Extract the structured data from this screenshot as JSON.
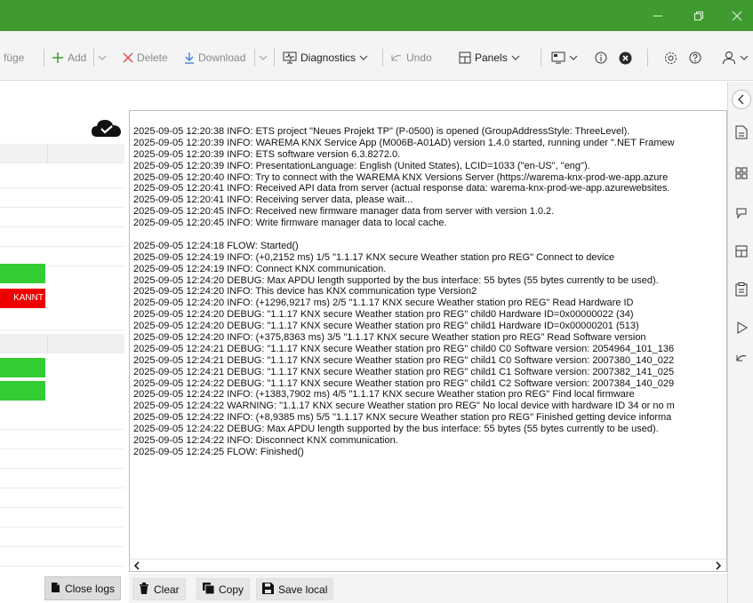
{
  "toolbar": {
    "insert_label": "füge",
    "add_label": "Add",
    "delete_label": "Delete",
    "download_label": "Download",
    "diagnostics_label": "Diagnostics",
    "undo_label": "Undo",
    "panels_label": "Panels"
  },
  "left_pane": {
    "red_cell_text": "KANNT"
  },
  "log": {
    "lines": [
      "2025-09-05 12:20:38 INFO: ETS project \"Neues Projekt TP\" (P-0500) is opened (GroupAddressStyle: ThreeLevel).",
      "2025-09-05 12:20:39 INFO: WAREMA KNX Service App (M006B-A01AD) version 1.4.0 started, running under \".NET Framew",
      "2025-09-05 12:20:39 INFO: ETS software version 6.3.8272.0.",
      "2025-09-05 12:20:39 INFO: PresentationLanguage: English (United States), LCID=1033 (\"en-US\", \"eng\").",
      "2025-09-05 12:20:40 INFO: Try to connect with the WAREMA KNX Versions Server (https://warema-knx-prod-we-app.azure",
      "2025-09-05 12:20:41 INFO: Received API data from server (actual response data: warema-knx-prod-we-app.azurewebsites.",
      "2025-09-05 12:20:41 INFO: Receiving server data, please wait...",
      "2025-09-05 12:20:45 INFO: Received new firmware manager data from server with version 1.0.2.",
      "2025-09-05 12:20:45 INFO: Write firmware manager data to local cache.",
      "",
      "2025-09-05 12:24:18 FLOW: Started()",
      "2025-09-05 12:24:19 INFO: (+0,2152 ms) 1/5 \"1.1.17 KNX secure Weather station pro REG\" Connect to device",
      "2025-09-05 12:24:19 INFO: Connect KNX communication.",
      "2025-09-05 12:24:20 DEBUG: Max APDU length supported by the bus interface: 55 bytes (55 bytes currently to be used).",
      "2025-09-05 12:24:20 INFO: This device has KNX communication type Version2",
      "2025-09-05 12:24:20 INFO: (+1296,9217 ms) 2/5 \"1.1.17 KNX secure Weather station pro REG\" Read Hardware ID",
      "2025-09-05 12:24:20 DEBUG: \"1.1.17 KNX secure Weather station pro REG\" child0 Hardware ID=0x00000022 (34)",
      "2025-09-05 12:24:20 DEBUG: \"1.1.17 KNX secure Weather station pro REG\" child1 Hardware ID=0x00000201 (513)",
      "2025-09-05 12:24:20 INFO: (+375,8363 ms) 3/5 \"1.1.17 KNX secure Weather station pro REG\" Read Software version",
      "2025-09-05 12:24:21 DEBUG: \"1.1.17 KNX secure Weather station pro REG\" child0 C0 Software version: 2054964_101_136",
      "2025-09-05 12:24:21 DEBUG: \"1.1.17 KNX secure Weather station pro REG\" child1 C0 Software version: 2007380_140_022",
      "2025-09-05 12:24:21 DEBUG: \"1.1.17 KNX secure Weather station pro REG\" child1 C1 Software version: 2007382_141_025",
      "2025-09-05 12:24:22 DEBUG: \"1.1.17 KNX secure Weather station pro REG\" child1 C2 Software version: 2007384_140_029",
      "2025-09-05 12:24:22 INFO: (+1383,7902 ms) 4/5 \"1.1.17 KNX secure Weather station pro REG\" Find local firmware",
      "2025-09-05 12:24:22 WARNING: \"1.1.17 KNX secure Weather station pro REG\" No local device with hardware ID 34 or no m",
      "2025-09-05 12:24:22 INFO: (+8,9385 ms) 5/5 \"1.1.17 KNX secure Weather station pro REG\" Finished getting device informa",
      "2025-09-05 12:24:22 DEBUG: Max APDU length supported by the bus interface: 55 bytes (55 bytes currently to be used).",
      "2025-09-05 12:24:22 INFO: Disconnect KNX communication.",
      "2025-09-05 12:24:25 FLOW: Finished()"
    ]
  },
  "buttons": {
    "close_logs": "Close logs",
    "clear": "Clear",
    "copy": "Copy",
    "save_local": "Save local"
  },
  "colors": {
    "titlebar": "#3f9b2f",
    "status_green": "#33cc33",
    "status_red": "#ee0000"
  }
}
